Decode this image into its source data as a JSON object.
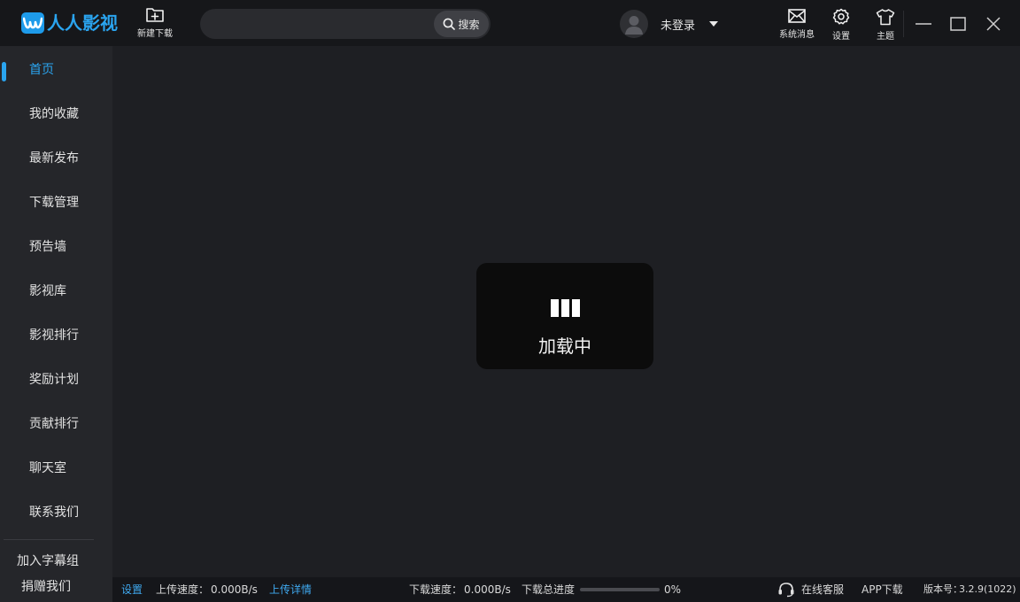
{
  "app": {
    "name": "人人影视",
    "brand_color": "#2aa4ef"
  },
  "header": {
    "new_download_label": "新建下载",
    "search": {
      "value": "",
      "placeholder": "",
      "button_label": "搜索"
    },
    "user": {
      "name": "未登录"
    },
    "tools": {
      "messages_label": "系统消息",
      "settings_label": "设置",
      "theme_label": "主题"
    }
  },
  "sidebar": {
    "items": [
      {
        "label": "首页",
        "active": true
      },
      {
        "label": "我的收藏"
      },
      {
        "label": "最新发布"
      },
      {
        "label": "下载管理"
      },
      {
        "label": "预告墙"
      },
      {
        "label": "影视库"
      },
      {
        "label": "影视排行"
      },
      {
        "label": "奖励计划"
      },
      {
        "label": "贡献排行"
      },
      {
        "label": "聊天室"
      },
      {
        "label": "联系我们"
      }
    ],
    "join_subtitle_group": "加入字幕组",
    "donate": "捐赠我们"
  },
  "main": {
    "loading_text": "加载中"
  },
  "status": {
    "settings": "设置",
    "upload_speed_label": "上传速度：",
    "upload_speed_value": "0.000B/s",
    "upload_details": "上传详情",
    "download_speed_label": "下载速度：",
    "download_speed_value": "0.000B/s",
    "total_progress_label": "下载总进度",
    "total_progress_value": "0%",
    "total_progress_fraction": 0,
    "online_service": "在线客服",
    "app_download": "APP下载",
    "version_label": "版本号：",
    "version_value": "3.2.9(1022)"
  }
}
